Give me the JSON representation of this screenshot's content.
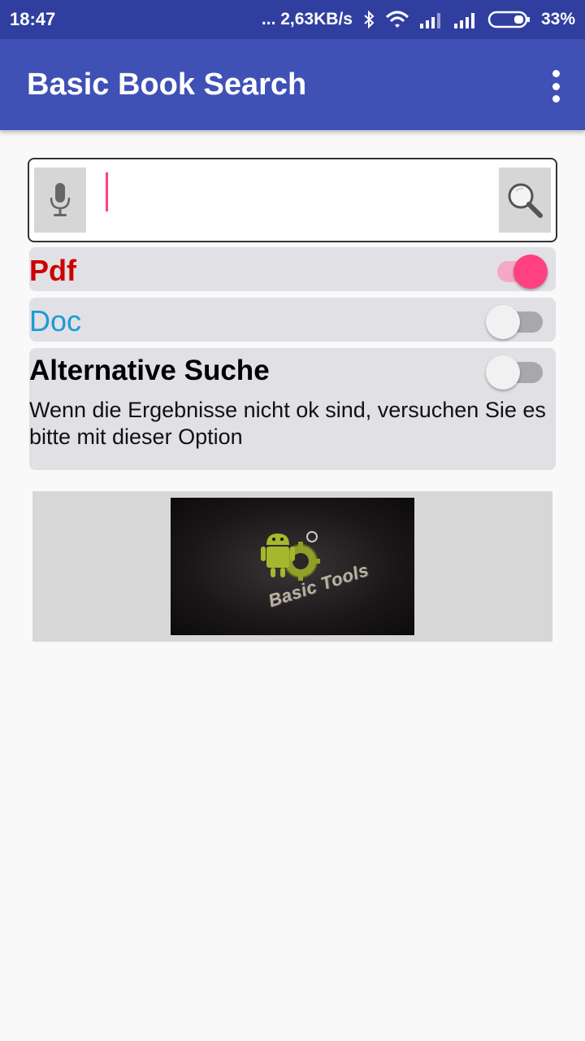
{
  "status_bar": {
    "time": "18:47",
    "network_speed": "... 2,63KB/s",
    "battery": "33%",
    "icons": [
      "bluetooth-icon",
      "wifi-icon",
      "signal-icon",
      "signal-icon",
      "battery-icon"
    ]
  },
  "app_bar": {
    "title": "Basic Book Search",
    "menu_icon": "more-vert-icon"
  },
  "search": {
    "value": "",
    "placeholder": "",
    "mic_icon": "microphone-icon",
    "search_icon": "search-icon"
  },
  "options": {
    "pdf": {
      "label": "Pdf",
      "checked": true,
      "color": "#cc0000"
    },
    "doc": {
      "label": "Doc",
      "checked": false,
      "color": "#1a9bd7"
    },
    "alternative": {
      "label": "Alternative Suche",
      "checked": false,
      "description": "Wenn die Ergebnisse nicht ok sind, versuchen Sie es bitte mit dieser Option"
    }
  },
  "banner": {
    "text": "Basic Tools",
    "logo": "android-gear-logo"
  },
  "colors": {
    "status_bar": "#303f9f",
    "app_bar": "#3f51b5",
    "accent": "#ff4081"
  }
}
